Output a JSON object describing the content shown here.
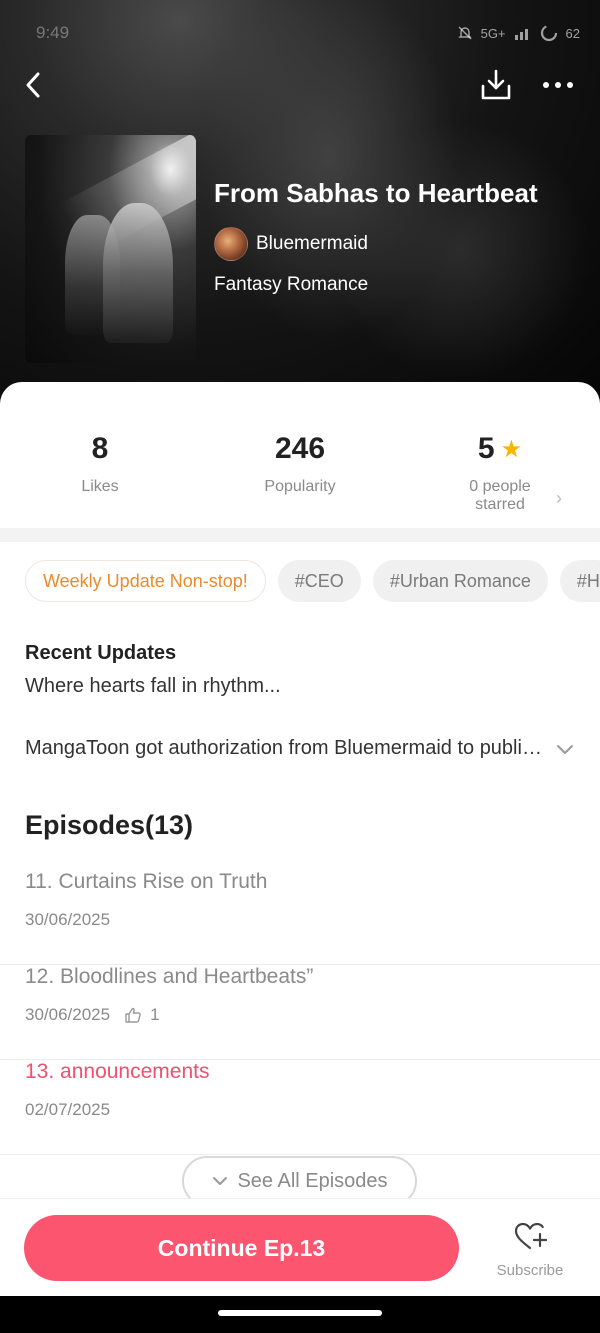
{
  "status_bar": {
    "time": "9:49",
    "network": "5G+",
    "battery": "62"
  },
  "comic": {
    "title": "From Sabhas to Heartbeat",
    "author": "Bluemermaid",
    "genre": "Fantasy Romance"
  },
  "stats": {
    "likes_value": "8",
    "likes_label": "Likes",
    "popularity_value": "246",
    "popularity_label": "Popularity",
    "rating_value": "5",
    "rating_label_line1": "0 people",
    "rating_label_line2": "starred"
  },
  "tags": [
    "Weekly Update Non-stop!",
    "#CEO",
    "#Urban Romance",
    "#H"
  ],
  "recent_updates": {
    "heading": "Recent Updates",
    "text": "Where hearts fall in rhythm..."
  },
  "description": "MangaToon got authorization from Bluemermaid to publish this work, the content is the author's own point of view, and does not represent the stand of MangaToon.",
  "episodes": {
    "heading": "Episodes(13)",
    "items": [
      {
        "title": "11. Curtains Rise on Truth",
        "date": "30/06/2025",
        "likes": ""
      },
      {
        "title": "12. Bloodlines and Heartbeats”",
        "date": "30/06/2025",
        "likes": "1"
      },
      {
        "title": "13. announcements",
        "date": "02/07/2025",
        "likes": ""
      }
    ],
    "see_all_label": "See All Episodes"
  },
  "bottom_bar": {
    "continue_label": "Continue Ep.13",
    "subscribe_label": "Subscribe"
  },
  "colors": {
    "accent": "#fb5570",
    "active_episode": "#f0506e",
    "tag_highlight": "#ee8a2a",
    "star": "#f7b500"
  }
}
